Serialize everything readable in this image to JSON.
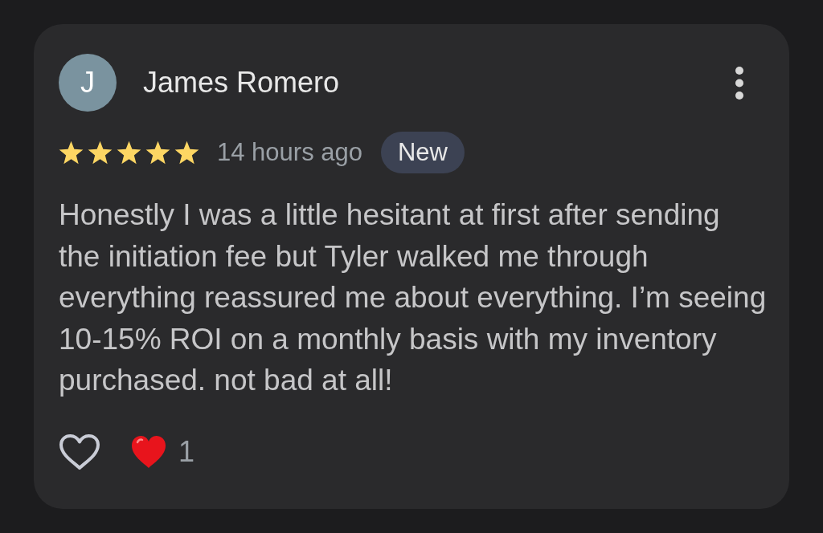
{
  "review": {
    "author": {
      "initial": "J",
      "name": "James Romero"
    },
    "stars": 5,
    "time": "14 hours ago",
    "badge": "New",
    "text": "Honestly I was a little hesitant at first after sending the initiation fee but Tyler walked me through everything reassured me about everything. I’m seeing 10-15% ROI on a monthly basis with my inventory purchased. not bad at all!",
    "like_button": {
      "liked": false
    },
    "reaction_count": "1"
  }
}
